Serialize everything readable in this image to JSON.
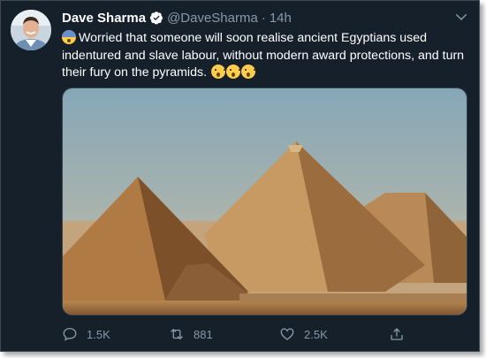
{
  "tweet": {
    "display_name": "Dave Sharma",
    "handle": "@DaveSharma",
    "separator": "·",
    "time": "14h",
    "text_lead_emoji": "fearful-face",
    "text": "Worried that someone will soon realise ancient Egyptians used indentured and slave labour, without modern award protections, and turn their fury on the pyramids.",
    "text_trail_emoji": [
      "hushed-face",
      "hushed-face",
      "hushed-face"
    ],
    "image_description_icon": "pyramids-photo"
  },
  "actions": {
    "reply_count": "1.5K",
    "retweet_count": "881",
    "like_count": "2.5K"
  },
  "icons": {
    "verified": "verified-badge-icon",
    "caret": "chevron-down-icon",
    "reply": "reply-icon",
    "retweet": "retweet-icon",
    "like": "heart-icon",
    "share": "share-icon"
  },
  "colors": {
    "background": "#15202b",
    "secondary_text": "#8899a6",
    "primary_text": "#ffffff"
  }
}
